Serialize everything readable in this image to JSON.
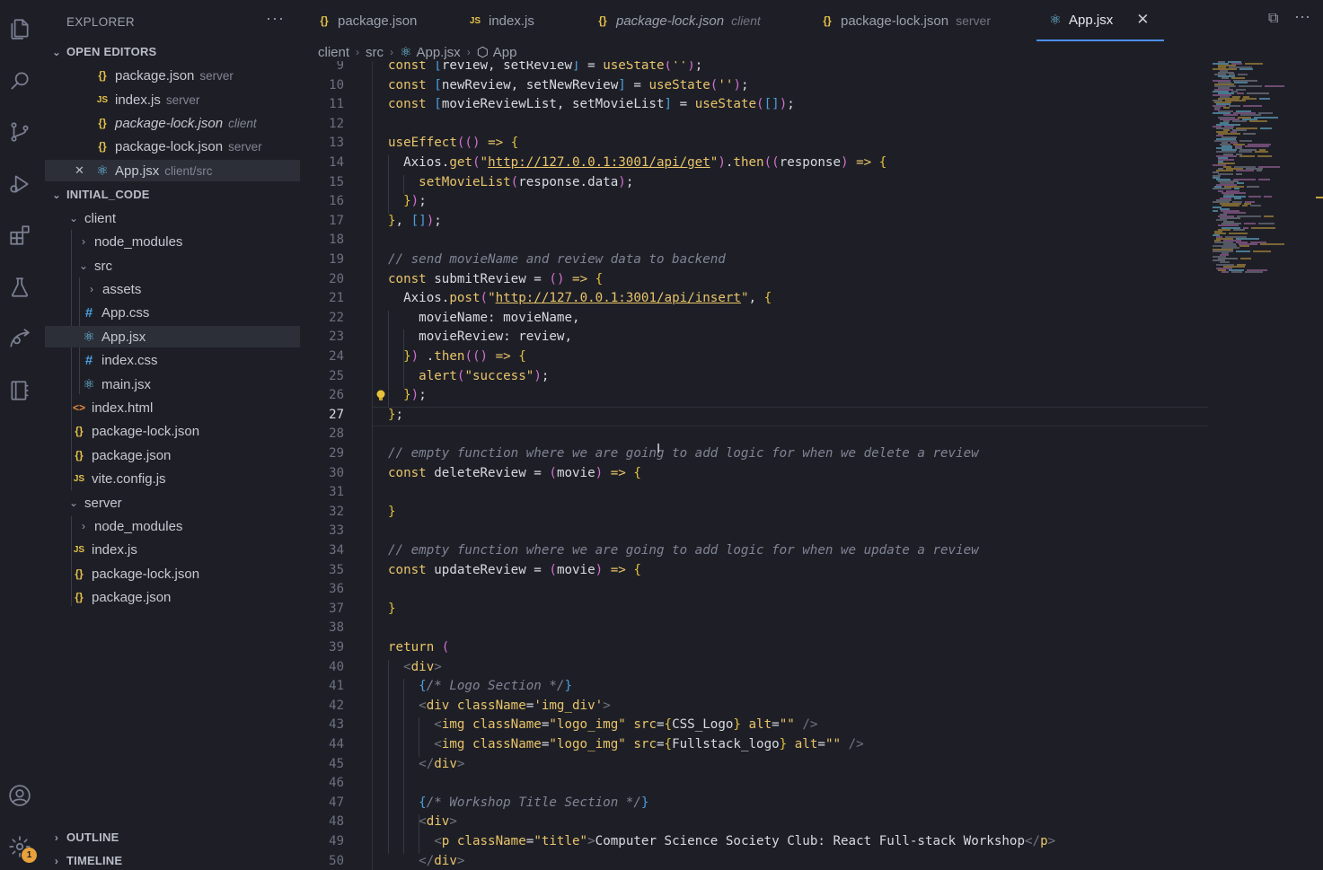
{
  "sidebar": {
    "title": "EXPLORER",
    "more": "···",
    "open_editors": {
      "label": "OPEN EDITORS",
      "items": [
        {
          "name": "package.json",
          "desc": "server",
          "kind": "json",
          "icon": "{}"
        },
        {
          "name": "index.js",
          "desc": "server",
          "kind": "js",
          "icon": "JS"
        },
        {
          "name": "package-lock.json",
          "desc": "client",
          "kind": "json",
          "icon": "{}",
          "italic": true
        },
        {
          "name": "package-lock.json",
          "desc": "server",
          "kind": "json",
          "icon": "{}"
        },
        {
          "name": "App.jsx",
          "desc": "client/src",
          "kind": "react",
          "icon": "⚛",
          "close": "✕"
        }
      ]
    },
    "project": {
      "label": "INITIAL_CODE",
      "tree": [
        {
          "name": "client",
          "chev": "⌄"
        },
        {
          "name": "node_modules",
          "chev": "›"
        },
        {
          "name": "src",
          "chev": "⌄"
        },
        {
          "name": "assets",
          "chev": "›"
        },
        {
          "name": "App.css",
          "icon": "#"
        },
        {
          "name": "App.jsx",
          "icon": "⚛"
        },
        {
          "name": "index.css",
          "icon": "#"
        },
        {
          "name": "main.jsx",
          "icon": "⚛"
        },
        {
          "name": "index.html",
          "icon": "<>"
        },
        {
          "name": "package-lock.json",
          "icon": "{}"
        },
        {
          "name": "package.json",
          "icon": "{}"
        },
        {
          "name": "vite.config.js",
          "icon": "JS"
        },
        {
          "name": "server",
          "chev": "⌄"
        },
        {
          "name": "node_modules",
          "chev": "›"
        },
        {
          "name": "index.js",
          "icon": "JS"
        },
        {
          "name": "package-lock.json",
          "icon": "{}"
        },
        {
          "name": "package.json",
          "icon": "{}"
        }
      ]
    },
    "outline": "OUTLINE",
    "timeline": "TIMELINE",
    "chev_down": "⌄",
    "chev_right": "›"
  },
  "tabs": [
    {
      "name": "package.json",
      "desc": "",
      "icon": "{}"
    },
    {
      "name": "index.js",
      "desc": "",
      "icon": "JS"
    },
    {
      "name": "package-lock.json",
      "desc": "client",
      "icon": "{}"
    },
    {
      "name": "package-lock.json",
      "desc": "server",
      "icon": "{}"
    },
    {
      "name": "App.jsx",
      "desc": "",
      "icon": "⚛",
      "close": "✕"
    }
  ],
  "tab_actions": {
    "split": "⧉",
    "more": "···"
  },
  "breadcrumb": {
    "parts": [
      "client",
      "src",
      "App.jsx",
      "App"
    ],
    "sep": "›",
    "react_icon": "⚛",
    "symbol_icon": "⬡"
  },
  "editor": {
    "current_line": 27,
    "lines": [
      {
        "n": "9",
        "html": "const [review, setReview] = useState('');"
      },
      {
        "n": "10",
        "html": "const [newReview, setNewReview] = useState('');"
      },
      {
        "n": "11",
        "html": "const [movieReviewList, setMovieList] = useState([]);"
      },
      {
        "n": "12",
        "html": ""
      },
      {
        "n": "13",
        "html": "useEffect(() => {"
      },
      {
        "n": "14",
        "html": "  Axios.get(\"http://127.0.0.1:3001/api/get\").then((response) => {"
      },
      {
        "n": "15",
        "html": "    setMovieList(response.data);"
      },
      {
        "n": "16",
        "html": "  });"
      },
      {
        "n": "17",
        "html": "}, []);"
      },
      {
        "n": "18",
        "html": ""
      },
      {
        "n": "19",
        "html": "// send movieName and review data to backend"
      },
      {
        "n": "20",
        "html": "const submitReview = () => {"
      },
      {
        "n": "21",
        "html": "  Axios.post(\"http://127.0.0.1:3001/api/insert\", {"
      },
      {
        "n": "22",
        "html": "    movieName: movieName,"
      },
      {
        "n": "23",
        "html": "    movieReview: review,"
      },
      {
        "n": "24",
        "html": "  }) .then(() => {"
      },
      {
        "n": "25",
        "html": "    alert(\"success\");"
      },
      {
        "n": "26",
        "html": "  });"
      },
      {
        "n": "27",
        "html": "};"
      },
      {
        "n": "28",
        "html": ""
      },
      {
        "n": "29",
        "html": "// empty function where we are going to add logic for when we delete a review"
      },
      {
        "n": "30",
        "html": "const deleteReview = (movie) => {"
      },
      {
        "n": "31",
        "html": ""
      },
      {
        "n": "32",
        "html": "}"
      },
      {
        "n": "33",
        "html": ""
      },
      {
        "n": "34",
        "html": "// empty function where we are going to add logic for when we update a review"
      },
      {
        "n": "35",
        "html": "const updateReview = (movie) => {"
      },
      {
        "n": "36",
        "html": ""
      },
      {
        "n": "37",
        "html": "}"
      },
      {
        "n": "38",
        "html": ""
      },
      {
        "n": "39",
        "html": "return ("
      },
      {
        "n": "40",
        "html": "  <div>"
      },
      {
        "n": "41",
        "html": "    {/* Logo Section */}"
      },
      {
        "n": "42",
        "html": "    <div className='img_div'>"
      },
      {
        "n": "43",
        "html": "      <img className=\"logo_img\" src={CSS_Logo} alt=\"\" />"
      },
      {
        "n": "44",
        "html": "      <img className=\"logo_img\" src={Fullstack_logo} alt=\"\" />"
      },
      {
        "n": "45",
        "html": "    </div>"
      },
      {
        "n": "46",
        "html": ""
      },
      {
        "n": "47",
        "html": "    {/* Workshop Title Section */}"
      },
      {
        "n": "48",
        "html": "    <div>"
      },
      {
        "n": "49",
        "html": "      <p className=\"title\">Computer Science Society Club: React Full-stack Workshop</p>"
      },
      {
        "n": "50",
        "html": "    </div>"
      }
    ]
  },
  "status": {
    "settings_badge": "1"
  },
  "colors": {
    "accent": "#4d8ff0",
    "background": "#1e1f26",
    "json_icon": "#e5c14b",
    "css_icon": "#4a9fe0",
    "react_icon": "#6ec3e6",
    "keyword": "#e9c46a",
    "comment": "#7f8495"
  }
}
